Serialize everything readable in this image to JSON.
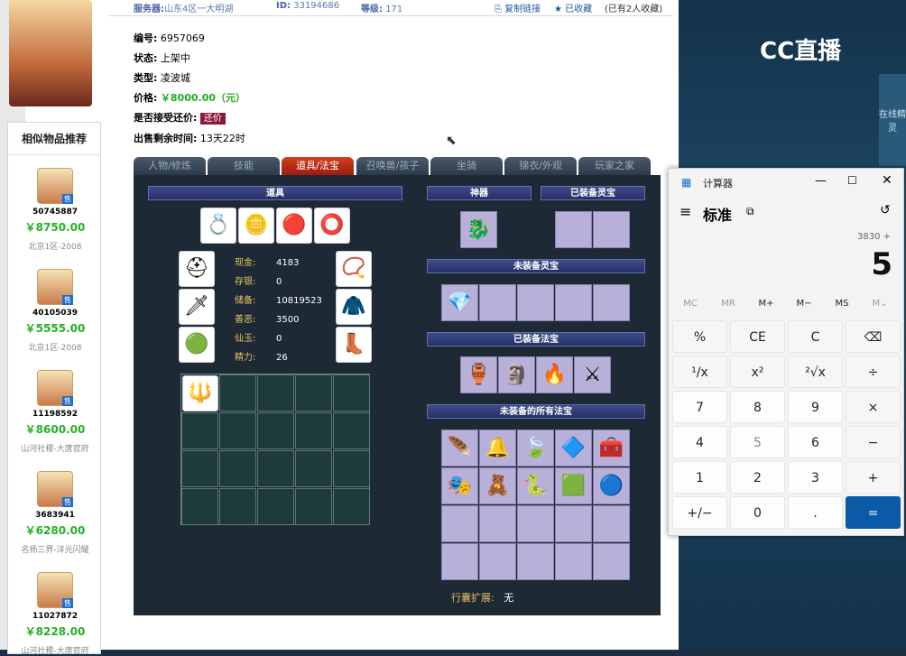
{
  "topbar": {
    "server_label": "服务器:",
    "server": "山东4区一大明湖",
    "id_label": "ID:",
    "id": "33194686",
    "level_label": "等级:",
    "level": "171",
    "copy_link": "复制链接",
    "favorited": "已收藏",
    "fav_count": "(已有2人收藏)"
  },
  "info": {
    "number_label": "编号:",
    "number": "6957069",
    "status_label": "状态:",
    "status": "上架中",
    "type_label": "类型:",
    "type": "凌波城",
    "price_label": "价格:",
    "price": "￥8000.00（元）",
    "accept_label": "是否接受还价:",
    "accept_btn": "还价",
    "time_label": "出售剩余时间:",
    "time": "13天22时"
  },
  "recommend": {
    "title": "相似物品推荐",
    "tag": "售",
    "items": [
      {
        "id": "50745887",
        "price": "￥8750.00",
        "server": "北京1区-2008"
      },
      {
        "id": "40105039",
        "price": "￥5555.00",
        "server": "北京1区-2008"
      },
      {
        "id": "11198592",
        "price": "￥8600.00",
        "server": "山河社稷-大唐官府"
      },
      {
        "id": "3683941",
        "price": "￥6280.00",
        "server": "名扬三界-洋光闪耀"
      },
      {
        "id": "11027872",
        "price": "￥8228.00",
        "server": "山河社稷-大唐官府"
      }
    ]
  },
  "tabs": [
    "人物/修炼",
    "技能",
    "道具/法宝",
    "召唤兽/孩子",
    "坐骑",
    "锦衣/外观",
    "玩家之家"
  ],
  "panel": {
    "items_header": "道具",
    "artifact_header": "神器",
    "equipped_spirit_header": "已装备灵宝",
    "unequipped_spirit_header": "未装备灵宝",
    "equipped_treasure_header": "已装备法宝",
    "unequipped_treasure_header": "未装备的所有法宝",
    "bag_label": "行囊扩展:",
    "bag_value": "无",
    "stats": [
      {
        "label": "现金:",
        "value": "4183"
      },
      {
        "label": "存银:",
        "value": "0"
      },
      {
        "label": "储备:",
        "value": "10819523"
      },
      {
        "label": "善恶:",
        "value": "3500"
      },
      {
        "label": "仙玉:",
        "value": "0"
      },
      {
        "label": "精力:",
        "value": "26"
      }
    ]
  },
  "calculator": {
    "title": "计算器",
    "mode": "标准",
    "expression": "3830 +",
    "display": "5",
    "memory": [
      "MC",
      "MR",
      "M+",
      "M−",
      "MS",
      "M⌄"
    ],
    "keys": [
      "%",
      "CE",
      "C",
      "⌫",
      "¹/x",
      "x²",
      "²√x",
      "÷",
      "7",
      "8",
      "9",
      "×",
      "4",
      "5",
      "6",
      "−",
      "1",
      "2",
      "3",
      "+",
      "+/−",
      "0",
      ".",
      "="
    ]
  },
  "stream": {
    "brand": "CC直播",
    "side_label": "在线精灵"
  },
  "colors": {
    "price_green": "#22aa22",
    "accent_blue": "#0b5aa8",
    "tab_active": "#c0301a"
  }
}
